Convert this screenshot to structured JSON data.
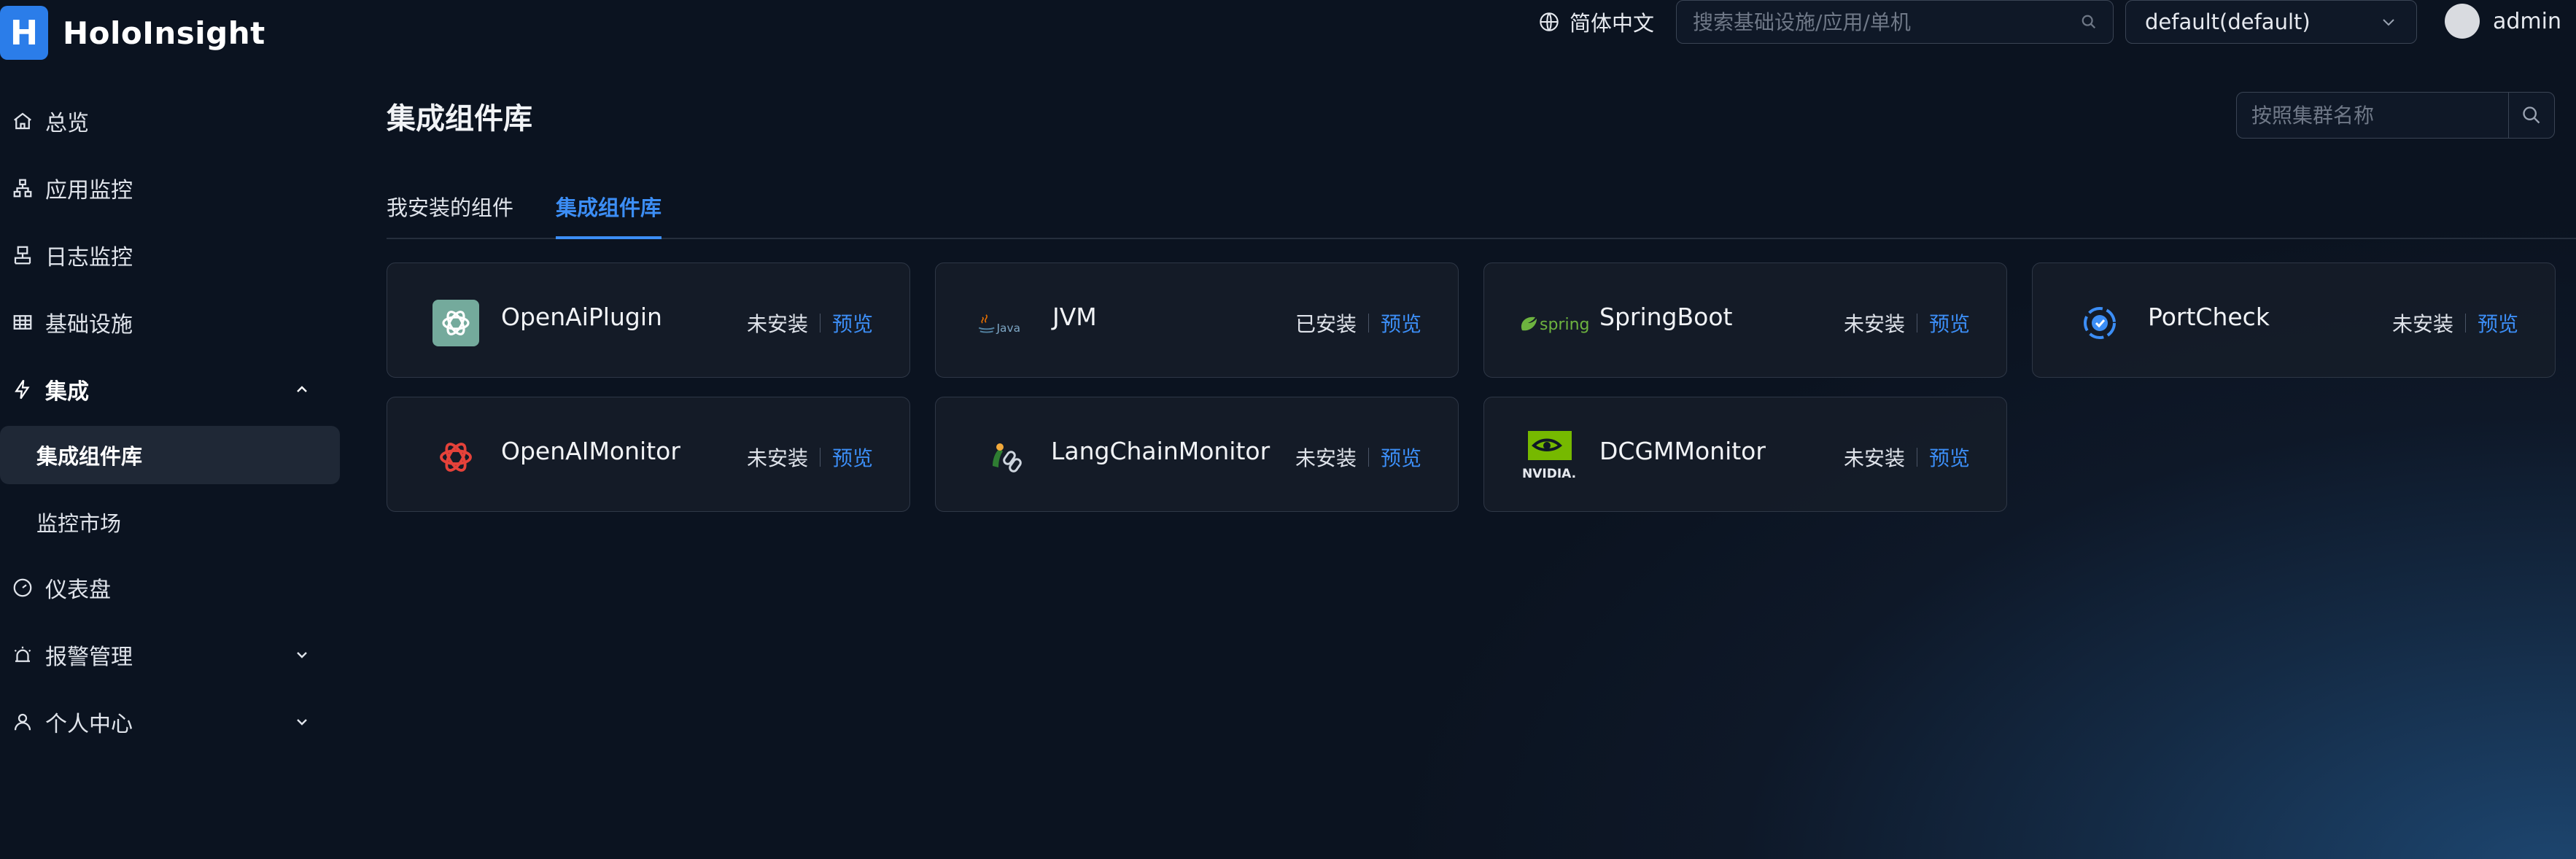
{
  "app": {
    "logo_letter": "H",
    "name": "HoloInsight"
  },
  "header": {
    "language": "简体中文",
    "search_placeholder": "搜索基础设施/应用/单机",
    "namespace": "default(default)",
    "username": "admin"
  },
  "sidebar": {
    "items": [
      {
        "label": "总览",
        "icon": "home-icon"
      },
      {
        "label": "应用监控",
        "icon": "sitemap-icon"
      },
      {
        "label": "日志监控",
        "icon": "log-icon"
      },
      {
        "label": "基础设施",
        "icon": "grid-table-icon"
      },
      {
        "label": "集成",
        "icon": "lightning-icon",
        "expanded": true,
        "children": [
          {
            "label": "集成组件库",
            "active": true
          },
          {
            "label": "监控市场"
          }
        ]
      },
      {
        "label": "仪表盘",
        "icon": "gauge-icon"
      },
      {
        "label": "报警管理",
        "icon": "alarm-icon"
      },
      {
        "label": "个人中心",
        "icon": "user-icon"
      }
    ]
  },
  "main": {
    "title": "集成组件库",
    "cluster_search_placeholder": "按照集群名称",
    "tabs": [
      {
        "label": "我安装的组件",
        "active": false
      },
      {
        "label": "集成组件库",
        "active": true
      }
    ],
    "preview_label": "预览",
    "cards": [
      {
        "name": "OpenAiPlugin",
        "status": "未安装",
        "logo": "openai-green-logo-icon"
      },
      {
        "name": "JVM",
        "status": "已安装",
        "logo": "java-logo-icon",
        "logo_text": "Java"
      },
      {
        "name": "SpringBoot",
        "status": "未安装",
        "logo": "spring-logo-icon",
        "logo_text": "spring"
      },
      {
        "name": "PortCheck",
        "status": "未安装",
        "logo": "port-check-logo-icon"
      },
      {
        "name": "OpenAIMonitor",
        "status": "未安装",
        "logo": "openai-red-logo-icon"
      },
      {
        "name": "LangChainMonitor",
        "status": "未安装",
        "logo": "langchain-logo-icon"
      },
      {
        "name": "DCGMMonitor",
        "status": "未安装",
        "logo": "nvidia-logo-icon",
        "logo_text": "NVIDIA."
      }
    ]
  },
  "colors": {
    "accent": "#3c8ef6",
    "logo_blue": "#2b7de9",
    "spring_green": "#6db33f",
    "nvidia_green": "#76b900",
    "openai_red": "#e5423a",
    "openai_green": "#74aa9c"
  }
}
